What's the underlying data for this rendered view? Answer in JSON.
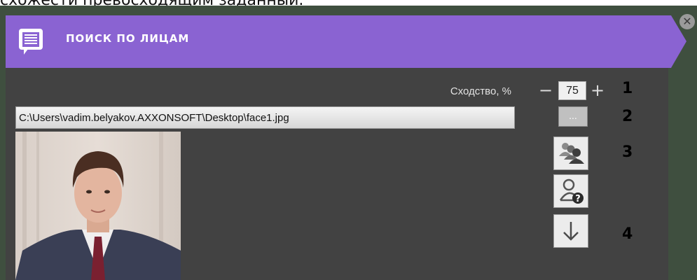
{
  "doc_text": "схожести превосходящим заданный.",
  "header": {
    "title": "ПОИСК ПО ЛИЦАМ"
  },
  "close": {
    "glyph": "✕"
  },
  "similarity": {
    "label": "Сходство, %",
    "value": "75",
    "minus": "−",
    "plus": "+"
  },
  "file": {
    "path": "C:\\Users\\vadim.belyakov.AXXONSOFT\\Desktop\\face1.jpg",
    "browse_label": "..."
  },
  "callouts": [
    "1",
    "2",
    "3",
    "4"
  ],
  "icons": {
    "header": "document-list-icon",
    "search_faces": "people-group-icon",
    "unknown_person": "person-question-icon",
    "download": "arrow-down-icon"
  },
  "colors": {
    "header": "#8a63d2",
    "panel": "#424242",
    "frame": "#3f4f3f"
  }
}
